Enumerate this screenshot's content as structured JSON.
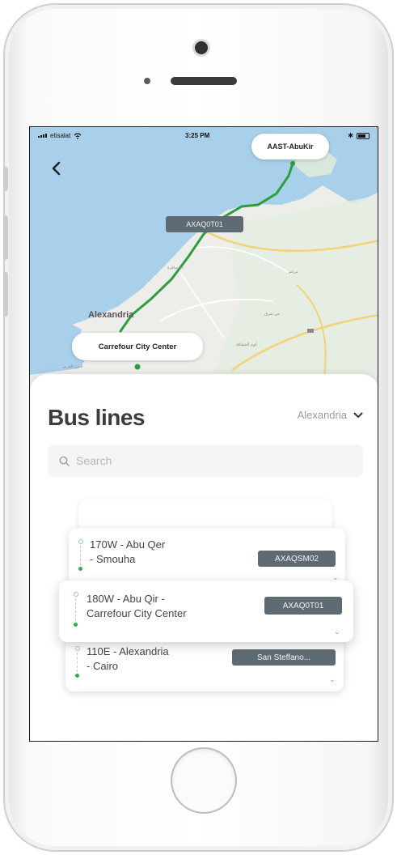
{
  "status_bar": {
    "carrier": "etisalat",
    "time": "3:25 PM"
  },
  "map": {
    "start_label": "AAST-AbuKir",
    "bus_label": "AXAQ0T01",
    "end_label": "Carrefour City Center",
    "place_labels": {
      "city": "Alexandria"
    },
    "route_color": "#2e9e3c",
    "sea_color": "#a8d0ea",
    "land_color": "#ededea"
  },
  "sheet": {
    "title": "Bus lines",
    "city_selector": "Alexandria",
    "search_placeholder": "Search"
  },
  "bus_lines": [
    {
      "name_line1": "170W - Abu Qer",
      "name_line2": "- Smouha",
      "tag": "AXAQSM02"
    },
    {
      "name_line1": "180W - Abu Qir -",
      "name_line2": "Carrefour City Center",
      "tag": "AXAQ0T01"
    },
    {
      "name_line1": "110E - Alexandria",
      "name_line2": "- Cairo",
      "tag": "San Steffano..."
    }
  ],
  "icons": {
    "back": "chevron-left-icon",
    "dropdown": "chevron-down-icon",
    "search": "search-icon",
    "card_expand": "chevron-down-icon"
  }
}
